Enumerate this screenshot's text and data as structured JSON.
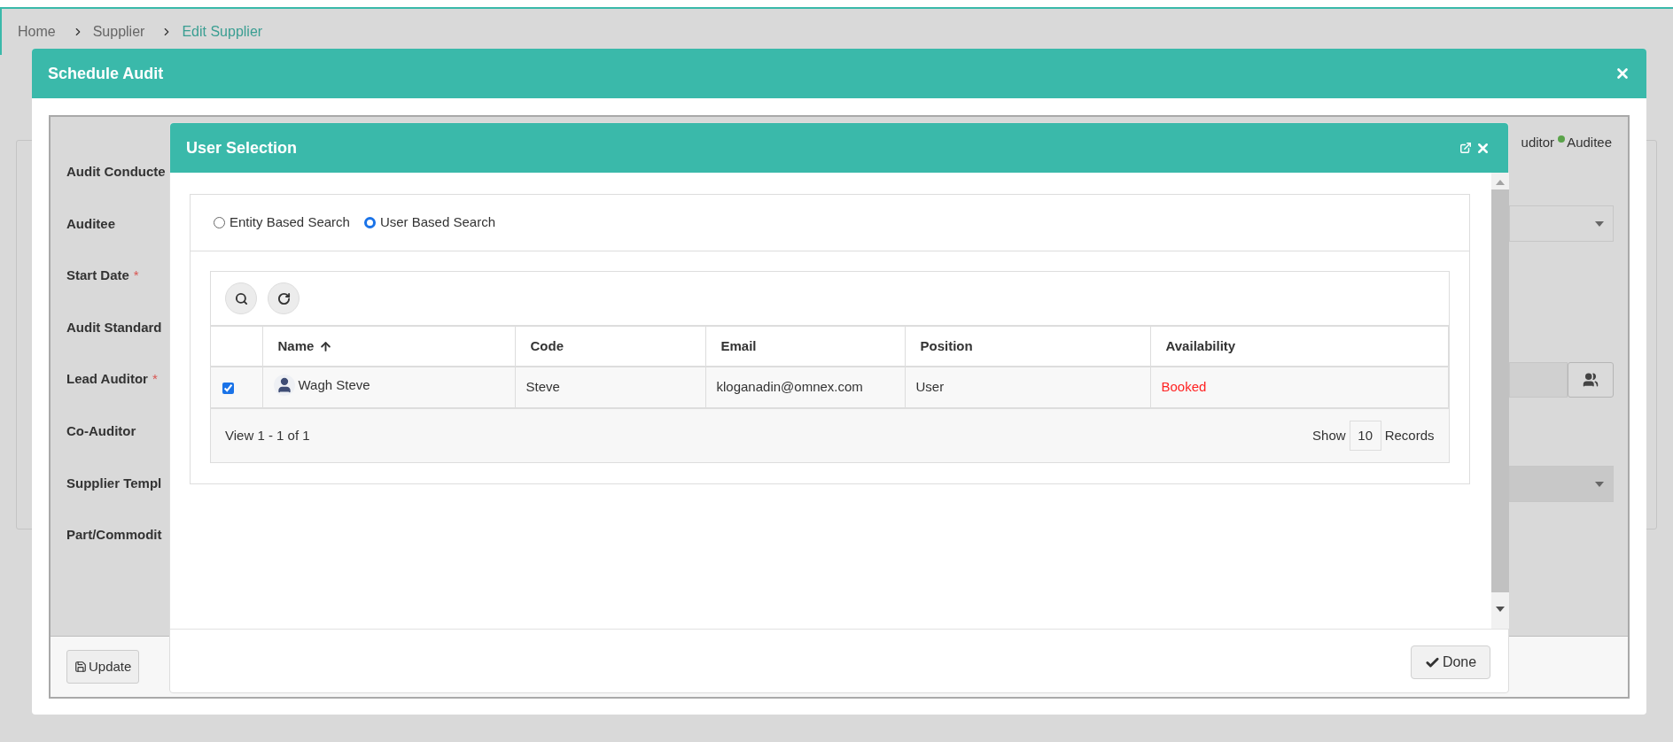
{
  "breadcrumb": [
    {
      "label": "Home",
      "current": false
    },
    {
      "label": "Supplier",
      "current": false
    },
    {
      "label": "Edit Supplier",
      "current": true
    }
  ],
  "schedule_audit": {
    "title": "Schedule Audit",
    "form_labels": [
      {
        "label": "Audit Conducte"
      },
      {
        "label": "Auditee"
      },
      {
        "label": "Start Date",
        "required_mark": "*"
      },
      {
        "label": "Audit Standard"
      },
      {
        "label": "Lead Auditor",
        "required_mark": "*"
      },
      {
        "label": "Co-Auditor"
      },
      {
        "label": "Supplier Templ"
      },
      {
        "label": "Part/Commodit"
      }
    ],
    "legend": [
      {
        "label": "uditor"
      },
      {
        "label": "Auditee",
        "color": "#5aa34a"
      }
    ],
    "buttons": [
      {
        "label": "Update"
      }
    ]
  },
  "user_selection": {
    "title": "User Selection",
    "search_modes": [
      {
        "label": "Entity Based Search",
        "selected": false
      },
      {
        "label": "User Based Search",
        "selected": true
      }
    ],
    "columns": [
      {
        "label": "Name",
        "sorted": true
      },
      {
        "label": "Code",
        "sorted": false
      },
      {
        "label": "Email",
        "sorted": false
      },
      {
        "label": "Position",
        "sorted": false
      },
      {
        "label": "Availability",
        "sorted": false
      }
    ],
    "rows": [
      {
        "checked": true,
        "name": "Wagh Steve",
        "code": "Steve",
        "email": "kloganadin@omnex.com",
        "position": "User",
        "availability": "Booked",
        "color": "#ff2222"
      }
    ],
    "pager": {
      "summary": "View 1 - 1 of 1",
      "show": "Show",
      "page_size": "10",
      "records": "Records"
    },
    "done": "Done"
  }
}
